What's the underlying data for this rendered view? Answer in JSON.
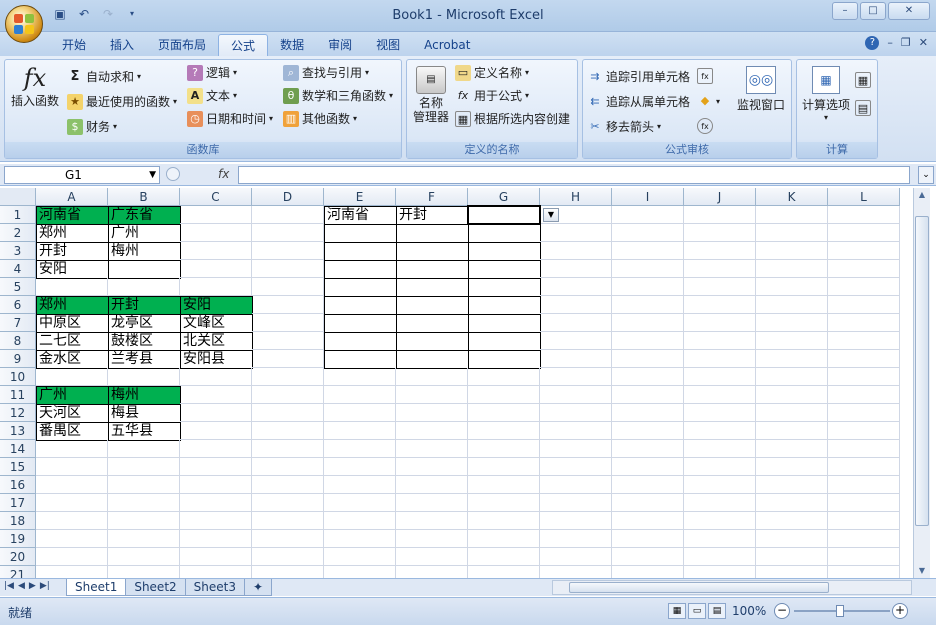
{
  "window": {
    "title": "Book1 - Microsoft Excel",
    "controls": [
      "–",
      "□",
      "✕"
    ]
  },
  "tabs": [
    "开始",
    "插入",
    "页面布局",
    "公式",
    "数据",
    "审阅",
    "视图",
    "Acrobat"
  ],
  "active_tab": "公式",
  "ribbon": {
    "function_library": {
      "label": "函数库",
      "insert_function": "插入函数",
      "autosum": "自动求和",
      "recent": "最近使用的函数",
      "financial": "财务",
      "logical": "逻辑",
      "text": "文本",
      "datetime": "日期和时间",
      "lookup": "查找与引用",
      "math": "数学和三角函数",
      "more": "其他函数"
    },
    "defined_names": {
      "label": "定义的名称",
      "name_manager": "名称\n管理器",
      "define_name": "定义名称",
      "use_in_formula": "用于公式",
      "create_from_selection": "根据所选内容创建"
    },
    "formula_auditing": {
      "label": "公式审核",
      "trace_precedents": "追踪引用单元格",
      "trace_dependents": "追踪从属单元格",
      "remove_arrows": "移去箭头",
      "watch_window": "监视窗口"
    },
    "calculation": {
      "label": "计算",
      "calc_options": "计算选项"
    }
  },
  "formula_bar": {
    "name_box": "G1",
    "fx": "fx",
    "formula": ""
  },
  "columns": [
    "A",
    "B",
    "C",
    "D",
    "E",
    "F",
    "G",
    "H",
    "I",
    "J",
    "K",
    "L"
  ],
  "rows": [
    "1",
    "2",
    "3",
    "4",
    "5",
    "6",
    "7",
    "8",
    "9",
    "10",
    "11",
    "12",
    "13",
    "14",
    "15",
    "16",
    "17",
    "18",
    "19",
    "20",
    "21"
  ],
  "cells": {
    "A1": "河南省",
    "B1": "广东省",
    "A2": "郑州",
    "B2": "广州",
    "A3": "开封",
    "B3": "梅州",
    "A4": "安阳",
    "A6": "郑州",
    "B6": "开封",
    "C6": "安阳",
    "A7": "中原区",
    "B7": "龙亭区",
    "C7": "文峰区",
    "A8": "二七区",
    "B8": "鼓楼区",
    "C8": "北关区",
    "A9": "金水区",
    "B9": "兰考县",
    "C9": "安阳县",
    "A11": "广州",
    "B11": "梅州",
    "A12": "天河区",
    "B12": "梅县",
    "A13": "番禺区",
    "B13": "五华县",
    "E1": "河南省",
    "F1": "开封"
  },
  "green_cells": [
    "A1",
    "B1",
    "A6",
    "B6",
    "C6",
    "A11",
    "B11"
  ],
  "colors": {
    "header_green": "#00b050"
  },
  "sheets": [
    "Sheet1",
    "Sheet2",
    "Sheet3"
  ],
  "active_sheet": "Sheet1",
  "status": {
    "ready": "就绪",
    "zoom": "100%"
  }
}
